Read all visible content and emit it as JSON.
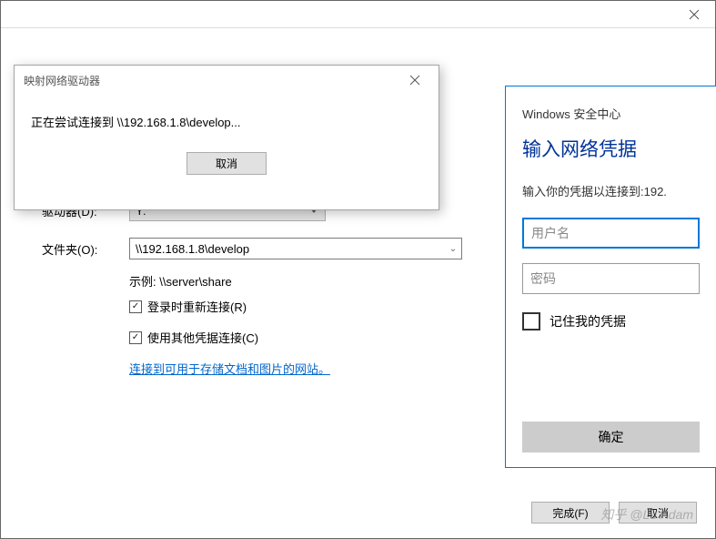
{
  "outer_dialog": {
    "close_icon": "close-icon"
  },
  "map_drive": {
    "drive_label": "驱动器(D):",
    "drive_value": "Y:",
    "folder_label": "文件夹(O):",
    "folder_value": "\\\\192.168.1.8\\develop",
    "example_text": "示例: \\\\server\\share",
    "checkbox_reconnect": "登录时重新连接(R)",
    "checkbox_different": "使用其他凭据连接(C)",
    "link_text": "连接到可用于存储文档和图片的网站。",
    "finish_label": "完成(F)",
    "cancel_label": "取消"
  },
  "credentials": {
    "subtitle": "Windows 安全中心",
    "heading": "输入网络凭据",
    "prompt": "输入你的凭据以连接到:192.",
    "username_placeholder": "用户名",
    "password_placeholder": "密码",
    "remember_label": "记住我的凭据",
    "ok_label": "确定"
  },
  "conn_modal": {
    "title": "映射网络驱动器",
    "message": "正在尝试连接到 \\\\192.168.1.8\\develop...",
    "cancel_label": "取消"
  },
  "watermark": "知乎 @Lu Adam"
}
